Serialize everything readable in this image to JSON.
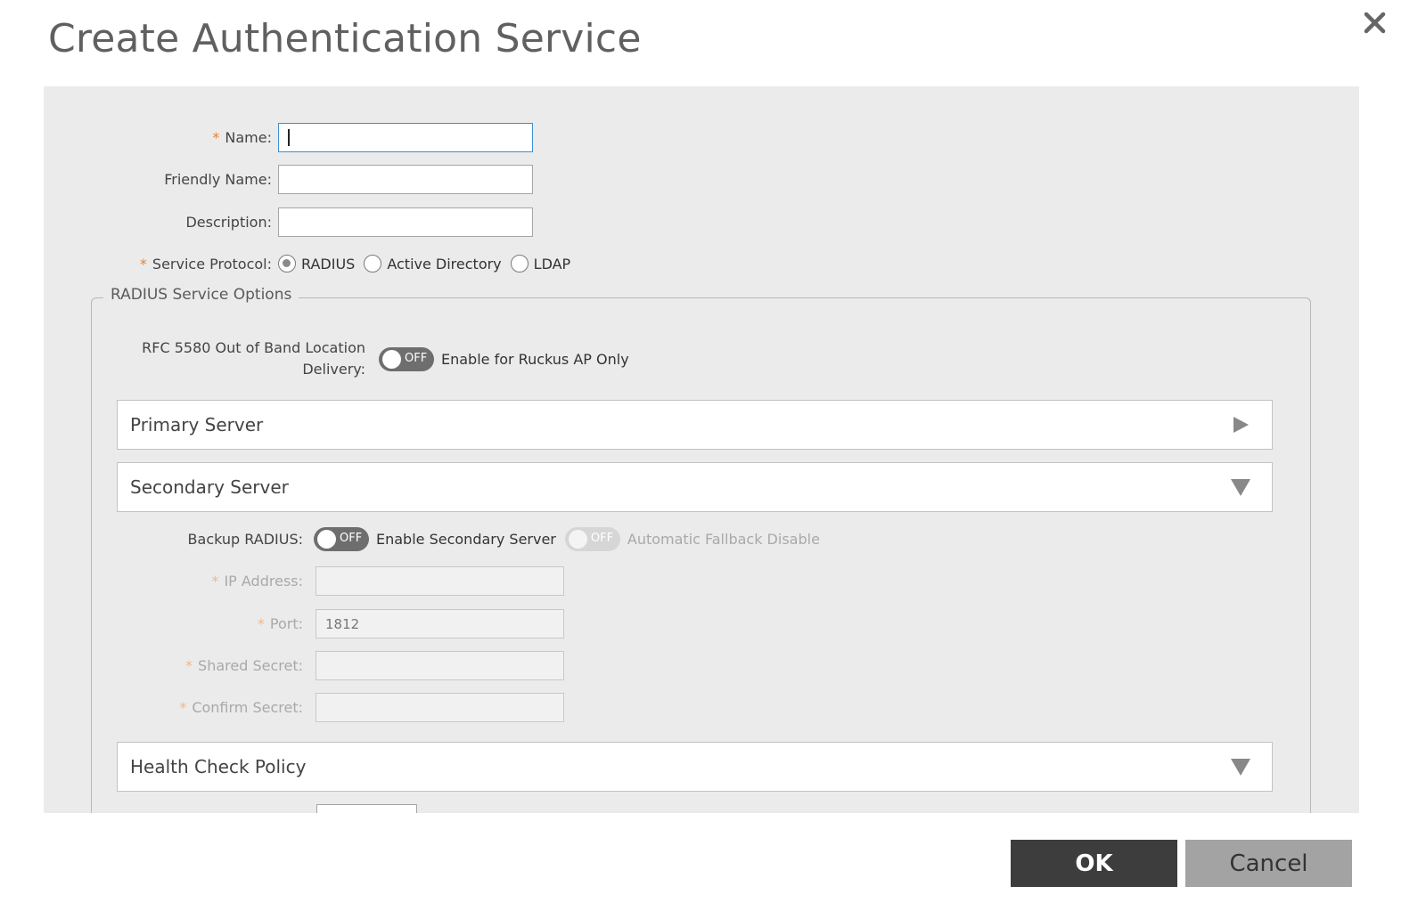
{
  "dialog": {
    "title": "Create Authentication Service"
  },
  "form": {
    "name": {
      "label": "Name:",
      "value": ""
    },
    "friendly_name": {
      "label": "Friendly Name:",
      "value": ""
    },
    "description": {
      "label": "Description:",
      "value": ""
    },
    "service_protocol": {
      "label": "Service Protocol:",
      "options": [
        "RADIUS",
        "Active Directory",
        "LDAP"
      ],
      "selected": "RADIUS"
    }
  },
  "radius_options": {
    "legend": "RADIUS Service Options",
    "rfc5580": {
      "label_line1": "RFC 5580 Out of Band Location",
      "label_line2": "Delivery:",
      "toggle_state": "OFF",
      "toggle_text": "Enable for Ruckus AP Only"
    },
    "primary_server": {
      "title": "Primary Server",
      "expanded": false
    },
    "secondary_server": {
      "title": "Secondary Server",
      "expanded": true,
      "backup_radius": {
        "label": "Backup RADIUS:",
        "toggle_state": "OFF",
        "toggle_text": "Enable Secondary Server",
        "fallback_toggle_state": "OFF",
        "fallback_text": "Automatic Fallback Disable"
      },
      "ip_address": {
        "label": "IP Address:",
        "value": ""
      },
      "port": {
        "label": "Port:",
        "value": "1812"
      },
      "shared_secret": {
        "label": "Shared Secret:",
        "value": ""
      },
      "confirm_secret": {
        "label": "Confirm Secret:",
        "value": ""
      }
    },
    "health_check": {
      "title": "Health Check Policy",
      "expanded": true
    }
  },
  "buttons": {
    "ok": "OK",
    "cancel": "Cancel"
  },
  "required_marker": "*"
}
